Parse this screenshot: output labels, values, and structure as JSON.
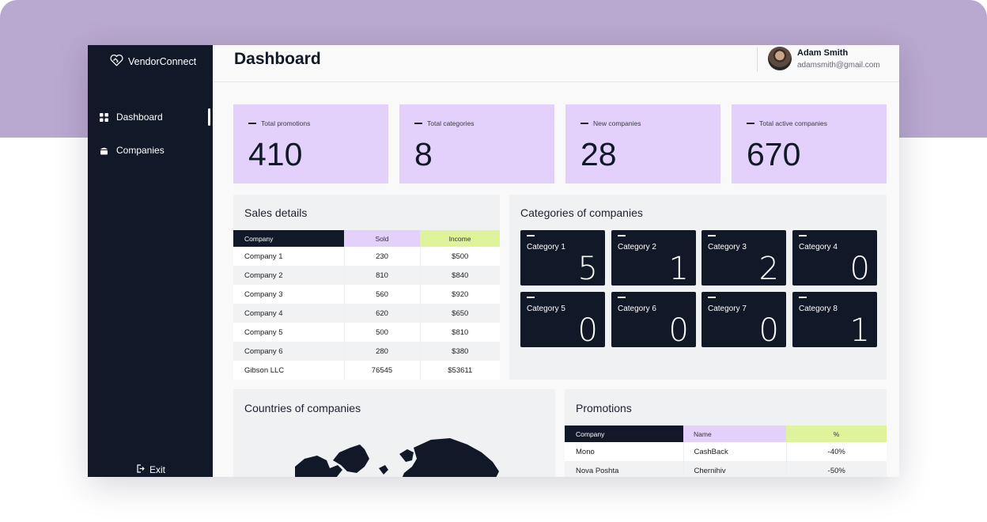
{
  "brand": {
    "name": "VendorConnect",
    "icon": "handshake-heart-icon"
  },
  "sidebar": {
    "items": [
      {
        "label": "Dashboard",
        "icon": "grid-icon",
        "active": true
      },
      {
        "label": "Companies",
        "icon": "building-icon",
        "active": false
      }
    ],
    "exit_label": "Exit"
  },
  "header": {
    "title": "Dashboard",
    "user": {
      "name": "Adam Smith",
      "email": "adamsmith@gmail.com"
    }
  },
  "stats": [
    {
      "label": "Total promotions",
      "value": "410"
    },
    {
      "label": "Total categories",
      "value": "8"
    },
    {
      "label": "New companies",
      "value": "28"
    },
    {
      "label": "Total active companies",
      "value": "670"
    }
  ],
  "sales": {
    "title": "Sales details",
    "columns": [
      "Company",
      "Sold",
      "Income"
    ],
    "rows": [
      [
        "Company 1",
        "230",
        "$500"
      ],
      [
        "Company 2",
        "810",
        "$840"
      ],
      [
        "Company 3",
        "560",
        "$920"
      ],
      [
        "Company 4",
        "620",
        "$650"
      ],
      [
        "Company 5",
        "500",
        "$810"
      ],
      [
        "Company 6",
        "280",
        "$380"
      ],
      [
        "Gibson LLC",
        "76545",
        "$53611"
      ]
    ]
  },
  "categories": {
    "title": "Categories of companies",
    "items": [
      {
        "name": "Category 1",
        "count": "5"
      },
      {
        "name": "Category 2",
        "count": "1"
      },
      {
        "name": "Category 3",
        "count": "2"
      },
      {
        "name": "Category 4",
        "count": "0"
      },
      {
        "name": "Category 5",
        "count": "0"
      },
      {
        "name": "Category 6",
        "count": "0"
      },
      {
        "name": "Category 7",
        "count": "0"
      },
      {
        "name": "Category 8",
        "count": "1"
      }
    ]
  },
  "countries": {
    "title": "Countries of companies"
  },
  "promotions": {
    "title": "Promotions",
    "columns": [
      "Company",
      "Name",
      "%"
    ],
    "rows": [
      [
        "Mono",
        "CashBack",
        "-40%"
      ],
      [
        "Nova Poshta",
        "Chernihiv",
        "-50%"
      ]
    ]
  },
  "colors": {
    "sidebar": "#111827",
    "stat_card": "#e4d1fb",
    "lime": "#dff49a",
    "backdrop": "#b9a8cf"
  }
}
